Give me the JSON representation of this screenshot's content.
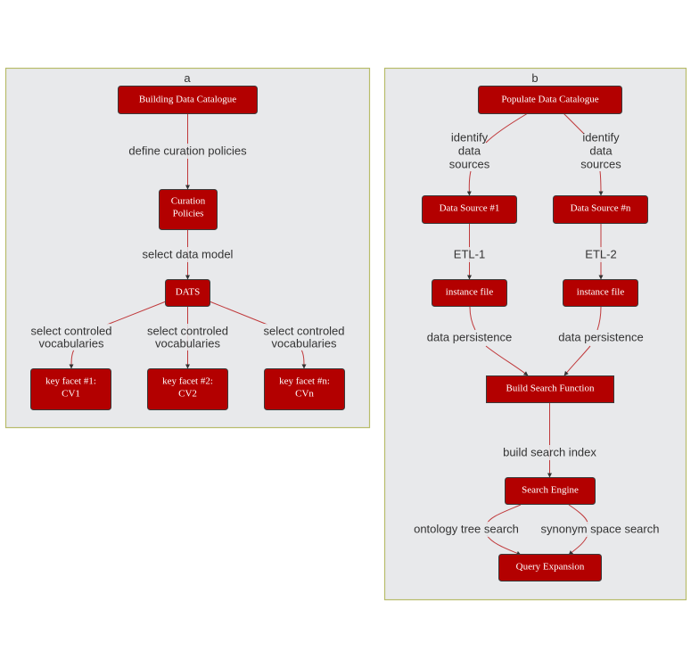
{
  "colors": {
    "node_fill": "#b30000",
    "node_stroke": "#3a3a3a",
    "edge": "#c0393b",
    "cluster_fill": "#e8e9eb",
    "cluster_stroke": "#b8bc6a",
    "label_text": "#333333",
    "node_text": "#ffffff"
  },
  "clusters": [
    {
      "id": "a",
      "label": "a",
      "nodes": [
        {
          "id": "building",
          "lines": [
            "Building Data Catalogue"
          ]
        },
        {
          "id": "curation",
          "lines": [
            "Curation",
            "Policies"
          ]
        },
        {
          "id": "dats",
          "lines": [
            "DATS"
          ]
        },
        {
          "id": "kf1",
          "lines": [
            "key facet #1:",
            "CV1"
          ]
        },
        {
          "id": "kf2",
          "lines": [
            "key facet #2:",
            "CV2"
          ]
        },
        {
          "id": "kfn",
          "lines": [
            "key facet #n:",
            "CVn"
          ]
        }
      ],
      "edges": [
        {
          "from": "building",
          "to": "curation",
          "label_lines": [
            "define curation policies"
          ]
        },
        {
          "from": "curation",
          "to": "dats",
          "label_lines": [
            "select data model"
          ]
        },
        {
          "from": "dats",
          "to": "kf1",
          "label_lines": [
            "select controled",
            "vocabularies"
          ]
        },
        {
          "from": "dats",
          "to": "kf2",
          "label_lines": [
            "select controled",
            "vocabularies"
          ]
        },
        {
          "from": "dats",
          "to": "kfn",
          "label_lines": [
            "select controled",
            "vocabularies"
          ]
        }
      ]
    },
    {
      "id": "b",
      "label": "b",
      "nodes": [
        {
          "id": "populate",
          "lines": [
            "Populate Data Catalogue"
          ]
        },
        {
          "id": "ds1",
          "lines": [
            "Data Source #1"
          ]
        },
        {
          "id": "dsn",
          "lines": [
            "Data Source #n"
          ]
        },
        {
          "id": "if1",
          "lines": [
            "instance file"
          ]
        },
        {
          "id": "if2",
          "lines": [
            "instance file"
          ]
        },
        {
          "id": "bsf",
          "lines": [
            "Build Search Function"
          ]
        },
        {
          "id": "se",
          "lines": [
            "Search Engine"
          ]
        },
        {
          "id": "qe",
          "lines": [
            "Query Expansion"
          ]
        }
      ],
      "edges": [
        {
          "from": "populate",
          "to": "ds1",
          "label_lines": [
            "identify",
            "data",
            "sources"
          ]
        },
        {
          "from": "populate",
          "to": "dsn",
          "label_lines": [
            "identify",
            "data",
            "sources"
          ]
        },
        {
          "from": "ds1",
          "to": "if1",
          "label_lines": [
            "ETL-1"
          ]
        },
        {
          "from": "dsn",
          "to": "if2",
          "label_lines": [
            "ETL-2"
          ]
        },
        {
          "from": "if1",
          "to": "bsf",
          "label_lines": [
            "data persistence"
          ]
        },
        {
          "from": "if2",
          "to": "bsf",
          "label_lines": [
            "data persistence"
          ]
        },
        {
          "from": "bsf",
          "to": "se",
          "label_lines": [
            "build search index"
          ]
        },
        {
          "from": "se",
          "to": "qe",
          "label_lines": [
            "ontology tree search"
          ]
        },
        {
          "from": "se",
          "to": "qe",
          "label_lines": [
            "synonym space search"
          ]
        }
      ]
    }
  ]
}
